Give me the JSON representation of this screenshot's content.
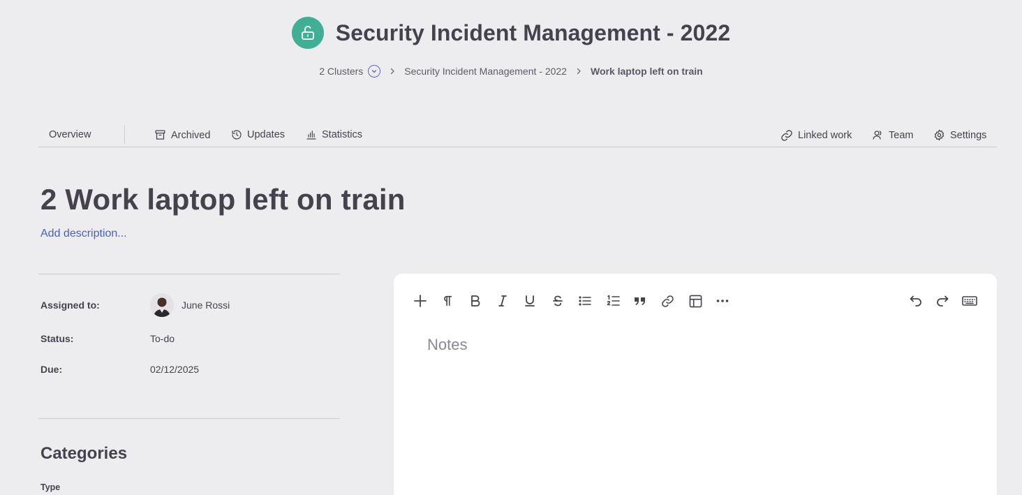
{
  "header": {
    "title": "Security Incident Management - 2022",
    "logo_icon": "lock-open-icon",
    "logo_color": "#43ae96"
  },
  "breadcrumb": {
    "clusters": "2 Clusters",
    "project": "Security Incident Management - 2022",
    "current": "Work laptop left on train"
  },
  "nav": {
    "overview": "Overview",
    "archived": "Archived",
    "updates": "Updates",
    "statistics": "Statistics",
    "linked_work": "Linked work",
    "team": "Team",
    "settings": "Settings"
  },
  "item": {
    "title": "2 Work laptop left on train",
    "add_description": "Add description..."
  },
  "fields": {
    "assigned_label": "Assigned to:",
    "assigned_value": "June Rossi",
    "status_label": "Status:",
    "status_value": "To-do",
    "due_label": "Due:",
    "due_value": "02/12/2025"
  },
  "categories": {
    "title": "Categories",
    "type_label": "Type"
  },
  "editor": {
    "placeholder": "Notes",
    "toolbar": [
      "plus-icon",
      "paragraph-icon",
      "bold-icon",
      "italic-icon",
      "underline-icon",
      "strikethrough-icon",
      "bullet-list-icon",
      "numbered-list-icon",
      "quote-icon",
      "link-icon",
      "table-icon",
      "more-icon",
      "undo-icon",
      "redo-icon",
      "keyboard-icon"
    ]
  },
  "colors": {
    "accent": "#4c5fbd",
    "background": "#ededef",
    "text": "#45424d"
  }
}
